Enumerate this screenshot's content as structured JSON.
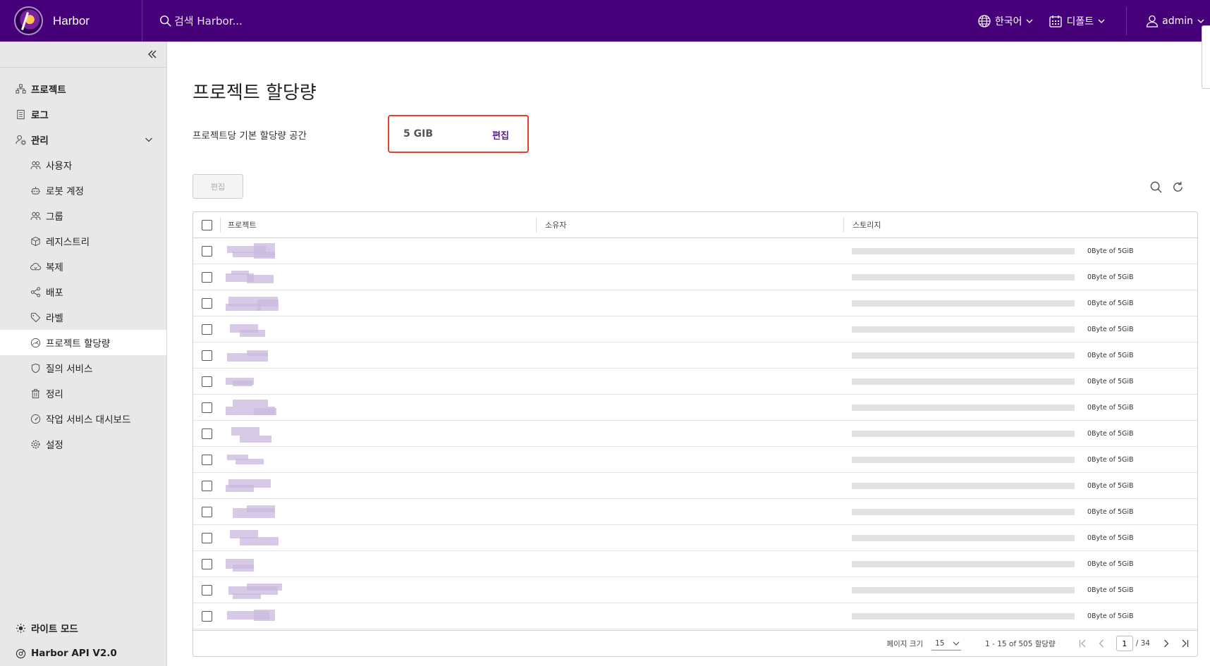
{
  "header": {
    "brand_name": "Harbor",
    "search_placeholder": "검색 Harbor...",
    "language": "한국어",
    "datetime_format": "디폴트",
    "user": "admin"
  },
  "sidebar": {
    "items": [
      {
        "label": "프로젝트",
        "icon": "projects-icon",
        "level": "top"
      },
      {
        "label": "로그",
        "icon": "logs-icon",
        "level": "top"
      },
      {
        "label": "관리",
        "icon": "admin-icon",
        "level": "top"
      },
      {
        "label": "사용자",
        "icon": "users-icon",
        "level": "sub"
      },
      {
        "label": "로봇 계정",
        "icon": "robot-icon",
        "level": "sub"
      },
      {
        "label": "그룹",
        "icon": "groups-icon",
        "level": "sub"
      },
      {
        "label": "레지스트리",
        "icon": "registry-icon",
        "level": "sub"
      },
      {
        "label": "복제",
        "icon": "replication-icon",
        "level": "sub"
      },
      {
        "label": "배포",
        "icon": "distribution-icon",
        "level": "sub"
      },
      {
        "label": "라벨",
        "icon": "tag-icon",
        "level": "sub"
      },
      {
        "label": "프로젝트 할당량",
        "icon": "gauge-icon",
        "level": "sub",
        "active": true
      },
      {
        "label": "질의 서비스",
        "icon": "shield-icon",
        "level": "sub"
      },
      {
        "label": "정리",
        "icon": "trash-icon",
        "level": "sub"
      },
      {
        "label": "작업 서비스 대시보드",
        "icon": "dashboard-icon",
        "level": "sub"
      },
      {
        "label": "설정",
        "icon": "gear-icon",
        "level": "sub"
      }
    ],
    "bottom": {
      "theme": "라이트 모드",
      "api": "Harbor API V2.0"
    }
  },
  "main": {
    "title": "프로젝트 할당량",
    "quota_label": "프로젝트당 기본 할당량 공간",
    "quota_value": "5 GIB",
    "quota_edit": "편집",
    "edit_button": "편집"
  },
  "table": {
    "headers": {
      "project": "프로젝트",
      "owner": "소유자",
      "storage": "스토리지"
    },
    "rows": [
      {
        "storage": "0Byte of 5GiB",
        "used_fraction": 0
      },
      {
        "storage": "0Byte of 5GiB",
        "used_fraction": 0
      },
      {
        "storage": "0Byte of 5GiB",
        "used_fraction": 0
      },
      {
        "storage": "0Byte of 5GiB",
        "used_fraction": 0
      },
      {
        "storage": "0Byte of 5GiB",
        "used_fraction": 0
      },
      {
        "storage": "0Byte of 5GiB",
        "used_fraction": 0
      },
      {
        "storage": "0Byte of 5GiB",
        "used_fraction": 0
      },
      {
        "storage": "0Byte of 5GiB",
        "used_fraction": 0
      },
      {
        "storage": "0Byte of 5GiB",
        "used_fraction": 0
      },
      {
        "storage": "0Byte of 5GiB",
        "used_fraction": 0
      },
      {
        "storage": "0Byte of 5GiB",
        "used_fraction": 0
      },
      {
        "storage": "0Byte of 5GiB",
        "used_fraction": 0
      },
      {
        "storage": "0Byte of 5GiB",
        "used_fraction": 0
      },
      {
        "storage": "0Byte of 5GiB",
        "used_fraction": 0
      },
      {
        "storage": "0Byte of 5GiB",
        "used_fraction": 0
      }
    ],
    "footer": {
      "page_size_label": "페이지 크기",
      "page_size": "15",
      "range": "1 - 15 of 505 할당량",
      "current_page": "1",
      "total_pages": "/ 34"
    }
  },
  "colors": {
    "header_bg": "#46007a",
    "accent": "#5c1a8f",
    "highlight_border": "#e0422b",
    "sidebar_bg": "#e8e8e8"
  }
}
